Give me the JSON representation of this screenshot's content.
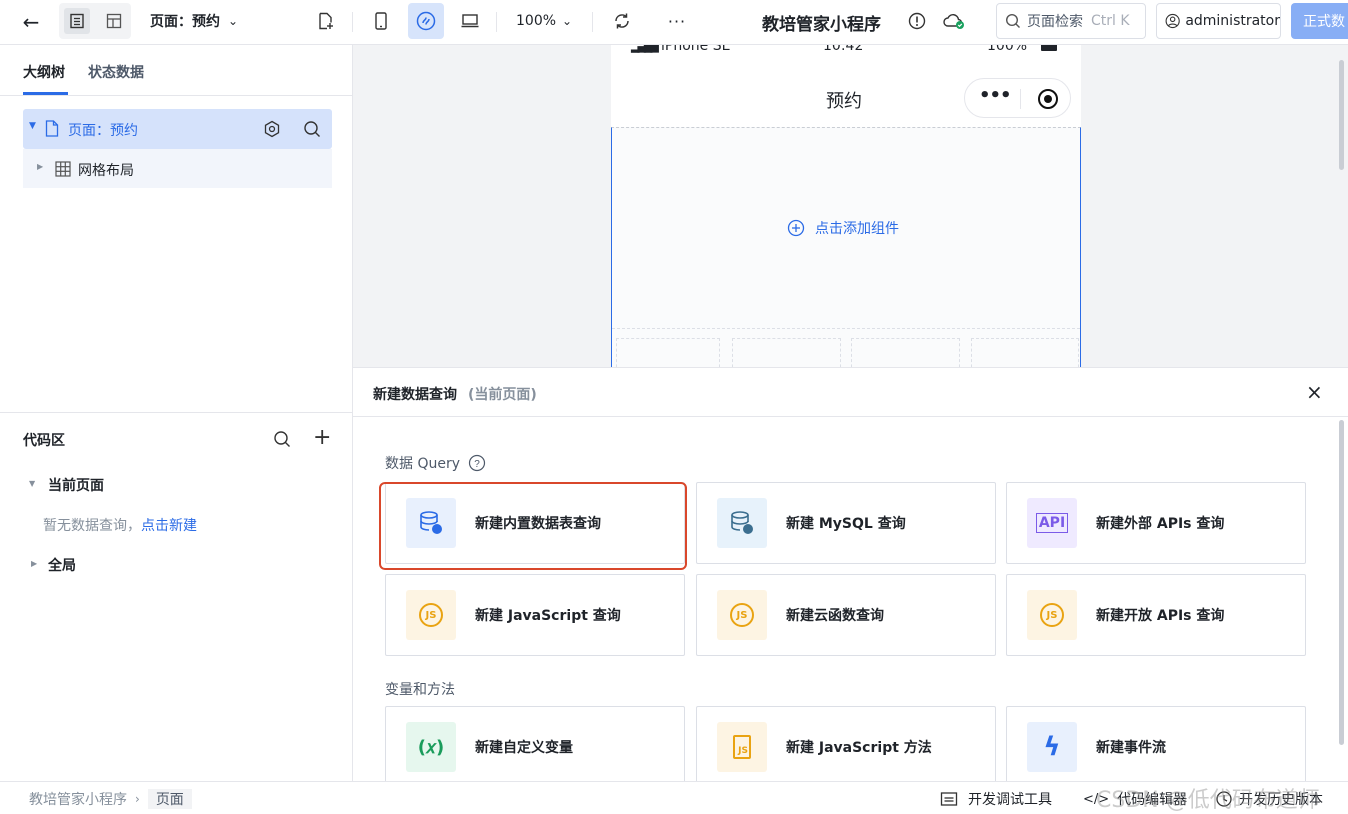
{
  "topbar": {
    "page_selector": "页面：预约",
    "zoom": "100%",
    "app_title": "教培管家小程序",
    "search_placeholder": "页面检索",
    "search_shortcut": "Ctrl K",
    "user": "administrator",
    "publish_label": "正式数"
  },
  "left": {
    "tabs": [
      "大纲树",
      "状态数据"
    ],
    "tree": {
      "page_label": "页面：预约",
      "child_label": "网格布局"
    },
    "code": {
      "title": "代码区",
      "current_page": "当前页面",
      "empty_text": "暂无数据查询，",
      "create_link": "点击新建",
      "global": "全局"
    }
  },
  "phone": {
    "carrier": "iPhone SE",
    "time": "10:42",
    "battery": "100%",
    "title": "预约",
    "add_component": "点击添加组件"
  },
  "panel": {
    "title": "新建数据查询",
    "subtitle": "(当前页面)",
    "section_query": "数据 Query",
    "section_vars": "变量和方法",
    "query_cards": [
      {
        "label": "新建内置数据表查询",
        "icon": "database-icon",
        "bg": "#e8f0fd",
        "color": "#2b6be6"
      },
      {
        "label": "新建 MySQL 查询",
        "icon": "mysql-icon",
        "bg": "#e7f2fb",
        "color": "#3b6e8f"
      },
      {
        "label": "新建外部 APIs 查询",
        "icon": "api-icon",
        "icon_text": "API",
        "bg": "#efeaff",
        "color": "#7b5be8"
      },
      {
        "label": "新建 JavaScript 查询",
        "icon": "js-search-icon",
        "icon_text": "JS",
        "bg": "#fdf4e3",
        "color": "#e9a312"
      },
      {
        "label": "新建云函数查询",
        "icon": "js-search-icon",
        "icon_text": "JS",
        "bg": "#fdf4e3",
        "color": "#e9a312"
      },
      {
        "label": "新建开放 APIs 查询",
        "icon": "js-search-icon",
        "icon_text": "JS",
        "bg": "#fdf4e3",
        "color": "#e9a312"
      }
    ],
    "var_cards": [
      {
        "label": "新建自定义变量",
        "icon": "variable-icon",
        "icon_text": "(𝑥)",
        "bg": "#e6f7ee",
        "color": "#1a9c5b"
      },
      {
        "label": "新建 JavaScript 方法",
        "icon": "js-file-icon",
        "icon_text": "JS",
        "bg": "#fdf4e3",
        "color": "#e9a312"
      },
      {
        "label": "新建事件流",
        "icon": "lightning-icon",
        "icon_text": "ϟ",
        "bg": "#e8f0fd",
        "color": "#2b6be6"
      }
    ]
  },
  "statusbar": {
    "breadcrumb": [
      "教培管家小程序",
      "页面"
    ],
    "dev_tools": "开发调试工具",
    "code_editor": "代码编辑器",
    "history": "开发历史版本",
    "watermark": "CSDN @低代码布道师"
  }
}
